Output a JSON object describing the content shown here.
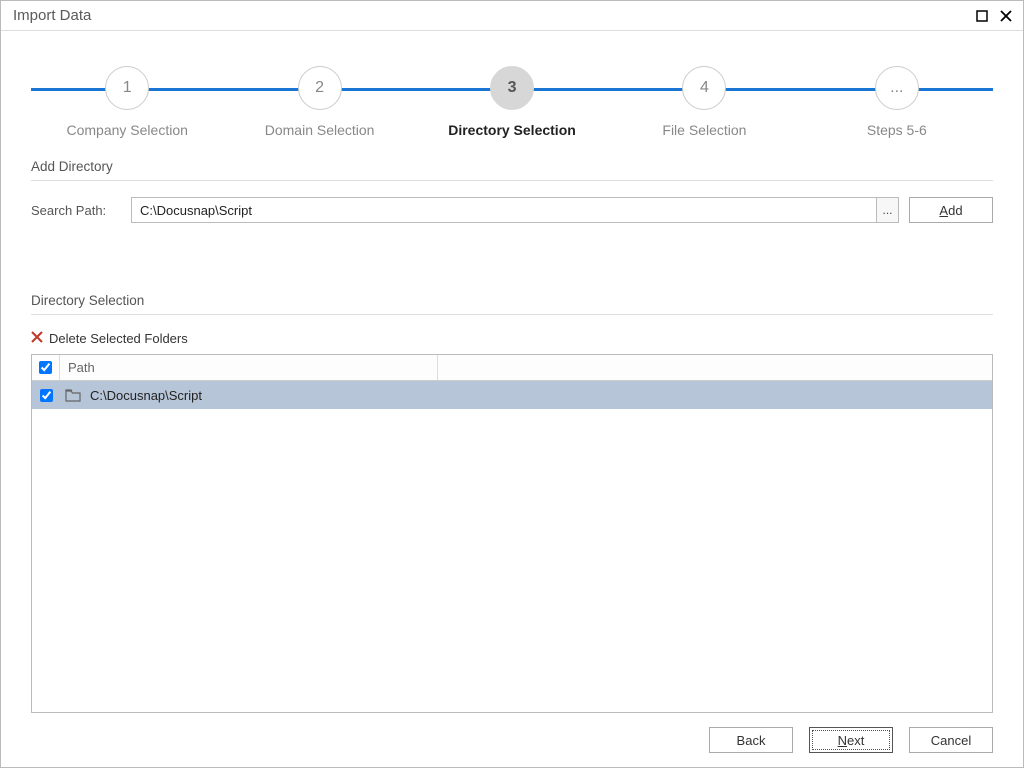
{
  "window": {
    "title": "Import Data"
  },
  "stepper": {
    "steps": [
      {
        "num": "1",
        "label": "Company Selection"
      },
      {
        "num": "2",
        "label": "Domain Selection"
      },
      {
        "num": "3",
        "label": "Directory Selection"
      },
      {
        "num": "4",
        "label": "File Selection"
      },
      {
        "num": "...",
        "label": "Steps 5-6"
      }
    ],
    "active_index": 2
  },
  "add_directory": {
    "section_title": "Add Directory",
    "search_path_label": "Search Path:",
    "search_path_value": "C:\\Docusnap\\Script",
    "browse_label": "...",
    "add_prefix": "A",
    "add_rest": "dd"
  },
  "directory_selection": {
    "section_title": "Directory Selection",
    "delete_label": "Delete Selected Folders",
    "columns": {
      "path": "Path"
    },
    "rows": [
      {
        "checked": true,
        "path": "C:\\Docusnap\\Script"
      }
    ]
  },
  "footer": {
    "back": "Back",
    "next_prefix": "N",
    "next_rest": "ext",
    "cancel": "Cancel"
  },
  "colors": {
    "accent": "#1976d2",
    "row_selected": "#b7c5d8",
    "delete_icon": "#c0392b"
  }
}
